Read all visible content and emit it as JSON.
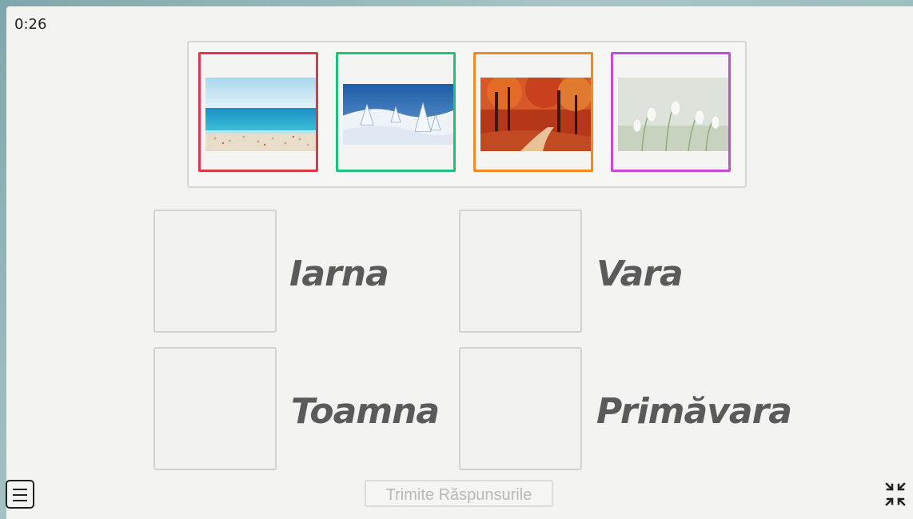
{
  "timer": "0:26",
  "cards": [
    {
      "name": "beach-image",
      "border_color": "#e0364a"
    },
    {
      "name": "snow-image",
      "border_color": "#1ec27a"
    },
    {
      "name": "autumn-forest-image",
      "border_color": "#f08a24"
    },
    {
      "name": "snowdrop-flowers-image",
      "border_color": "#c94ad8"
    }
  ],
  "targets": [
    {
      "label": "Iarna"
    },
    {
      "label": "Vara"
    },
    {
      "label": "Toamna"
    },
    {
      "label": "Primăvara"
    }
  ],
  "submit_label": "Trimite Răspunsurile",
  "icons": {
    "menu": "hamburger-icon",
    "collapse": "collapse-fullscreen-icon"
  }
}
